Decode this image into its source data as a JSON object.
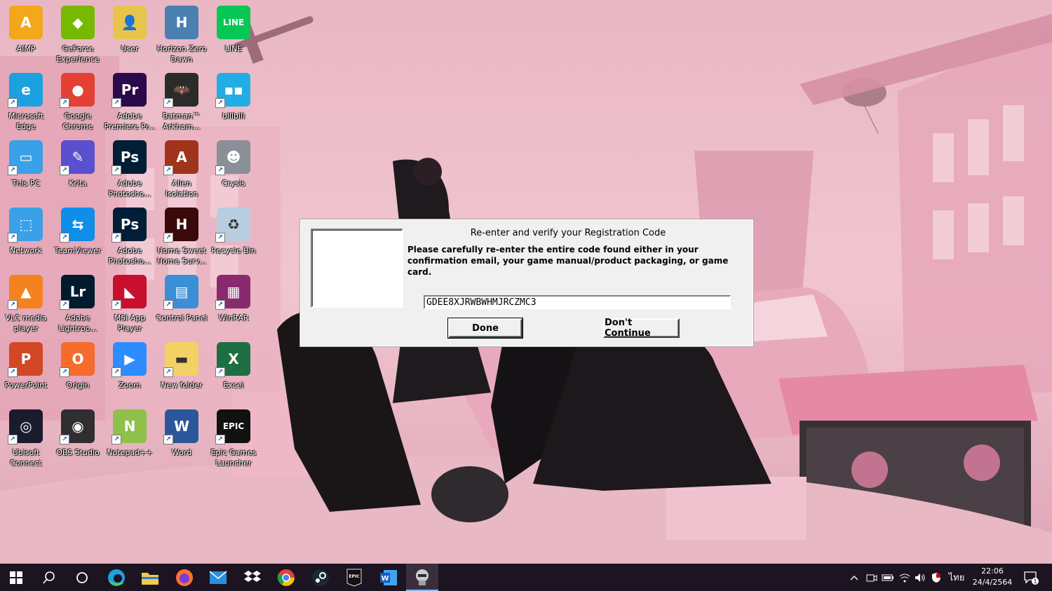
{
  "desktop": {
    "icons": [
      {
        "label": "AIMP",
        "icon": "aimp-icon",
        "color": "#f3a71b"
      },
      {
        "label": "GeForce\nExperience",
        "icon": "geforce-icon",
        "color": "#76b900"
      },
      {
        "label": "User",
        "icon": "user-folder-icon",
        "color": "#e8c54a"
      },
      {
        "label": "Horizon Zero\nDawn",
        "icon": "horizon-zero-dawn-icon",
        "color": "#4a7fb0"
      },
      {
        "label": "LINE",
        "icon": "line-icon",
        "color": "#06c755"
      },
      {
        "label": "Microsoft\nEdge",
        "icon": "edge-icon",
        "color": "#1ba0e0"
      },
      {
        "label": "Google\nChrome",
        "icon": "chrome-icon",
        "color": "#e34133"
      },
      {
        "label": "Adobe\nPremiere Pr...",
        "icon": "premiere-icon",
        "color": "#2a0a4a"
      },
      {
        "label": "Batman™\nArkham...",
        "icon": "batman-icon",
        "color": "#2b2b2b"
      },
      {
        "label": "bilibili",
        "icon": "bilibili-icon",
        "color": "#23ade5"
      },
      {
        "label": "This PC",
        "icon": "this-pc-icon",
        "color": "#3aa0e8"
      },
      {
        "label": "Krita",
        "icon": "krita-icon",
        "color": "#5a4fcf"
      },
      {
        "label": "Adobe\nPhotosho...",
        "icon": "photoshop-icon",
        "color": "#001e36"
      },
      {
        "label": "Alien\nIsolation",
        "icon": "alien-isolation-icon",
        "color": "#a0341a"
      },
      {
        "label": "Crysis",
        "icon": "crysis-icon",
        "color": "#8a8f98"
      },
      {
        "label": "Network",
        "icon": "network-icon",
        "color": "#3aa0e8"
      },
      {
        "label": "TeamViewer",
        "icon": "teamviewer-icon",
        "color": "#0e8ee9"
      },
      {
        "label": "Adobe\nPhotosho...",
        "icon": "photoshop-icon",
        "color": "#001e36"
      },
      {
        "label": "Home Sweet\nHome Surv...",
        "icon": "home-sweet-home-icon",
        "color": "#3a0a0a"
      },
      {
        "label": "Recycle Bin",
        "icon": "recycle-bin-icon",
        "color": "#b8cde0"
      },
      {
        "label": "VLC media\nplayer",
        "icon": "vlc-icon",
        "color": "#f58220"
      },
      {
        "label": "Adobe\nLightroo...",
        "icon": "lightroom-icon",
        "color": "#001a2e"
      },
      {
        "label": "MSI App\nPlayer",
        "icon": "msi-app-player-icon",
        "color": "#c8102e"
      },
      {
        "label": "Control Panel",
        "icon": "control-panel-icon",
        "color": "#3a8fd6"
      },
      {
        "label": "WinRAR",
        "icon": "winrar-icon",
        "color": "#8a2a6e"
      },
      {
        "label": "PowerPoint",
        "icon": "powerpoint-icon",
        "color": "#d24726"
      },
      {
        "label": "Origin",
        "icon": "origin-icon",
        "color": "#f56c2d"
      },
      {
        "label": "Zoom",
        "icon": "zoom-icon",
        "color": "#2d8cff"
      },
      {
        "label": "New folder",
        "icon": "folder-icon",
        "color": "#f2d264"
      },
      {
        "label": "Excel",
        "icon": "excel-icon",
        "color": "#1d6f42"
      },
      {
        "label": "Ubisoft\nConnect",
        "icon": "ubisoft-icon",
        "color": "#1b1b2e"
      },
      {
        "label": "OBS Studio",
        "icon": "obs-icon",
        "color": "#302e31"
      },
      {
        "label": "Notepad++",
        "icon": "notepadpp-icon",
        "color": "#8fc04a"
      },
      {
        "label": "Word",
        "icon": "word-icon",
        "color": "#2b579a"
      },
      {
        "label": "Epic Games\nLauncher",
        "icon": "epic-games-icon",
        "color": "#111111"
      }
    ]
  },
  "dialog": {
    "title": "Re-enter and verify your Registration Code",
    "message": "Please carefully re-enter the entire code found either in your confirmation email, your game manual/product packaging, or game card.",
    "code_value": "GDEE8XJRWBWHMJRCZMC3",
    "done_label": "Done",
    "dont_continue_label": "Don't Continue"
  },
  "taskbar": {
    "apps": [
      {
        "icon": "start-icon"
      },
      {
        "icon": "search-icon"
      },
      {
        "icon": "cortana-icon"
      },
      {
        "icon": "edge-icon"
      },
      {
        "icon": "file-explorer-icon"
      },
      {
        "icon": "firefox-icon"
      },
      {
        "icon": "mail-icon"
      },
      {
        "icon": "dropbox-icon"
      },
      {
        "icon": "chrome-icon"
      },
      {
        "icon": "steam-icon"
      },
      {
        "icon": "epic-games-icon"
      },
      {
        "icon": "word-icon"
      },
      {
        "icon": "crysis-icon"
      }
    ],
    "tray": {
      "language": "ไทย",
      "time": "22:06",
      "date": "24/4/2564",
      "notification_count": "1"
    }
  },
  "colors": {
    "taskbar_bg": "#1c1420",
    "dialog_bg": "#f0f0f0",
    "wallpaper_pink": "#e8b4c2"
  }
}
